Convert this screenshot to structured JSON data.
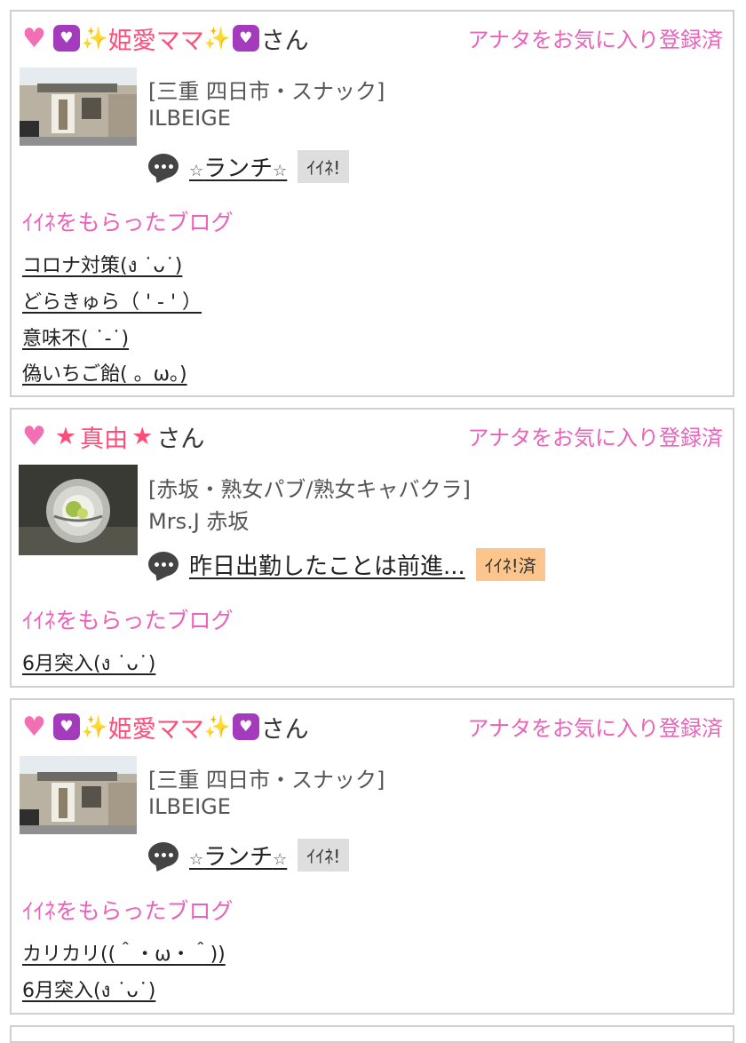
{
  "cards": [
    {
      "name": "姫愛ママ",
      "suffix": "さん",
      "favorite_label": "アナタをお気に入り登録済",
      "shop_category": "[三重 四日市・スナック]",
      "shop_name": "ILBEIGE",
      "blog_title": "ランチ",
      "iine_label": "ｲｲﾈ!",
      "liked_heading": "ｲｲﾈをもらったブログ",
      "liked_blogs": [
        "コロナ対策(ง ˙ᴗ˙)",
        "どらきゅら（ ' - ' ）",
        "意味不( ˙-˙)",
        "偽いちご飴( 。ω。)"
      ]
    },
    {
      "name": "真由",
      "suffix": "さん",
      "favorite_label": "アナタをお気に入り登録済",
      "shop_category": "[赤坂・熟女パブ/熟女キャバクラ]",
      "shop_name": "Mrs.J 赤坂",
      "blog_title": "昨日出勤したことは前進...",
      "iine_label": "ｲｲﾈ!済",
      "liked_heading": "ｲｲﾈをもらったブログ",
      "liked_blogs": [
        "6月突入(ง ˙ᴗ˙)"
      ]
    },
    {
      "name": "姫愛ママ",
      "suffix": "さん",
      "favorite_label": "アナタをお気に入り登録済",
      "shop_category": "[三重 四日市・スナック]",
      "shop_name": "ILBEIGE",
      "blog_title": "ランチ",
      "iine_label": "ｲｲﾈ!",
      "liked_heading": "ｲｲﾈをもらったブログ",
      "liked_blogs": [
        "カリカリ((＾・ω・＾))",
        "6月突入(ง ˙ᴗ˙)"
      ]
    }
  ],
  "decor": {
    "star_glyph": "★",
    "small_star_glyph": "☆",
    "sparkle_glyph": "✨",
    "heart_glyph": "♥",
    "purple_heart_glyph": "♥",
    "accent_pink": "#ea63bb",
    "name_red": "#ff4d79",
    "iine_gray": "#dedede",
    "iine_done_orange": "#fcc58e"
  }
}
